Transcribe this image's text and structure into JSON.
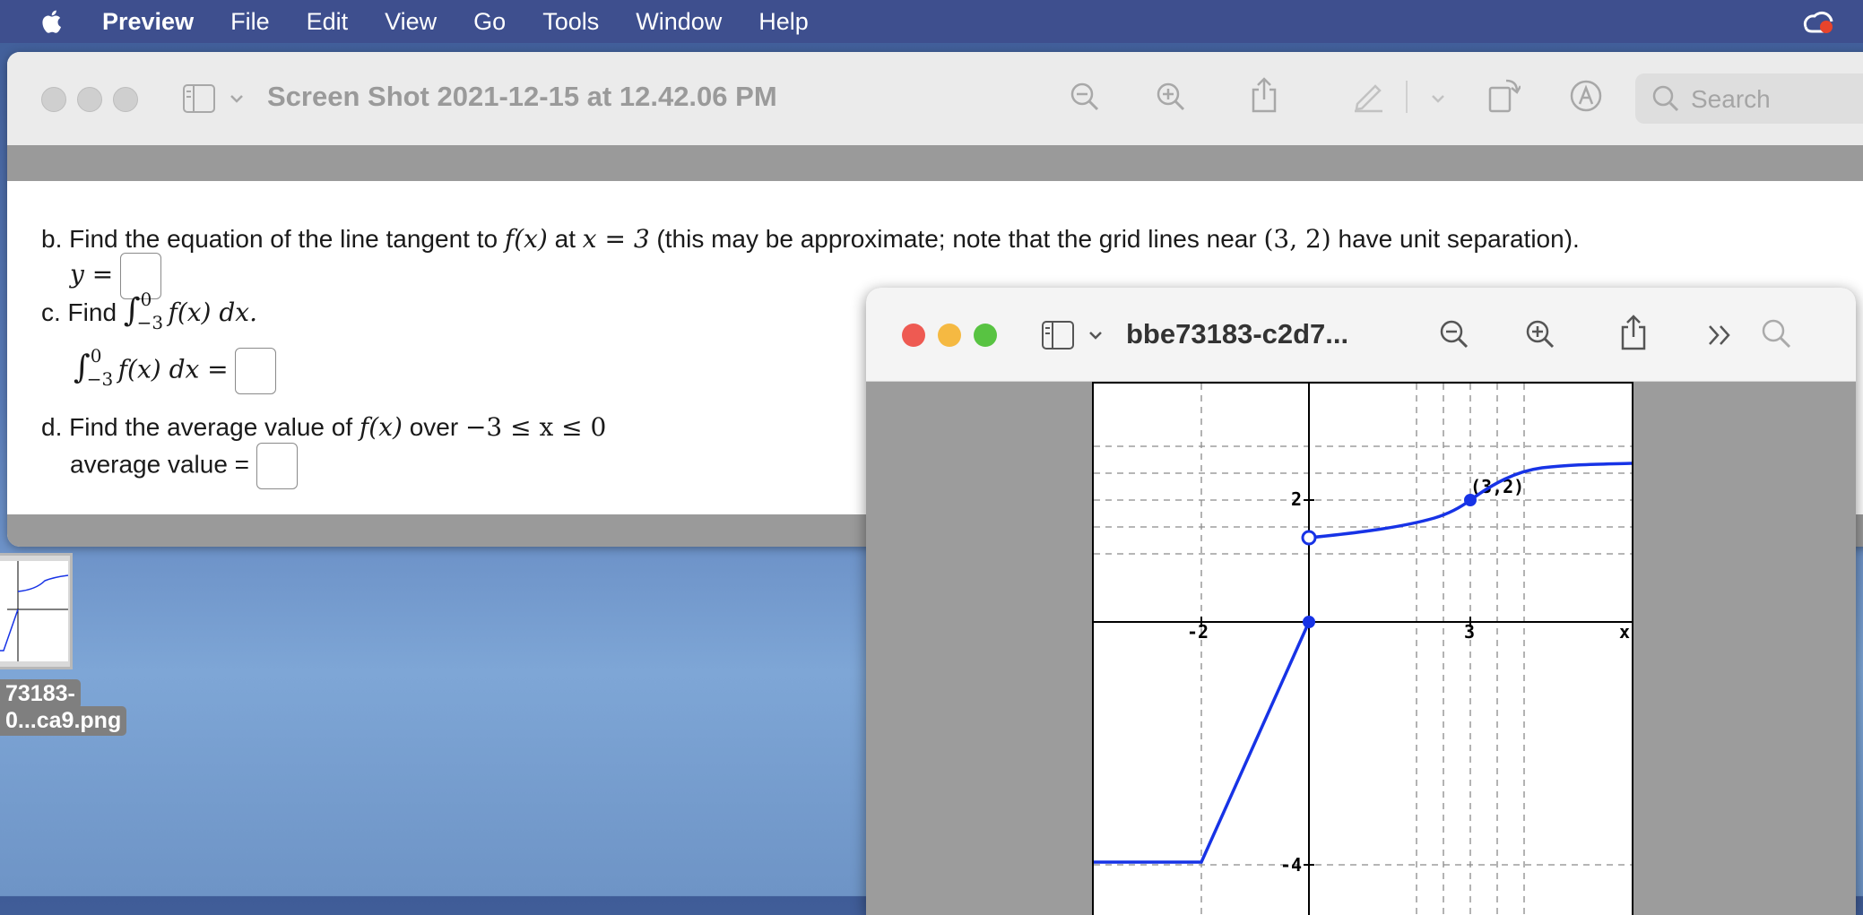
{
  "menubar": {
    "app": "Preview",
    "items": [
      "File",
      "Edit",
      "View",
      "Go",
      "Tools",
      "Window",
      "Help"
    ]
  },
  "window_main": {
    "title": "Screen Shot 2021-12-15 at 12.42.06 PM",
    "search_placeholder": "Search"
  },
  "document": {
    "b_prefix": "b. Find the equation of the line tangent to ",
    "b_fx": "f(x)",
    "b_at": " at ",
    "b_eq": "x = 3",
    "b_mid": " (this may be approximate; note that the grid lines near ",
    "b_point": "(3, 2)",
    "b_suffix": " have unit separation).",
    "b_answer_label": "y =",
    "c_prefix": "c. Find ",
    "c_integral": "∫",
    "c_upper": "0",
    "c_lower": "−3",
    "c_integrand": " f(x) dx.",
    "c_answer_integral": "∫",
    "c_answer_integrand": " f(x) dx =",
    "d_prefix": "d. Find the average value of ",
    "d_fx": "f(x)",
    "d_over": " over ",
    "d_range": "−3 ≤ x ≤ 0",
    "d_answer_label": "average value ="
  },
  "desktop_file": {
    "label_line1": "73183-",
    "label_line2": "0...ca9.png"
  },
  "window_graph": {
    "title": "bbe73183-c2d7...",
    "axis_labels": {
      "x_neg2": "-2",
      "x_3": "3",
      "x_end": "x",
      "y_2": "2",
      "y_neg4": "-4"
    },
    "point_label": "(3,2)"
  },
  "colors": {
    "menubar": "#3e4f8e",
    "curve": "#1733e6",
    "close": "#ee5a52",
    "minimize": "#f5b942",
    "zoom": "#58c342"
  }
}
